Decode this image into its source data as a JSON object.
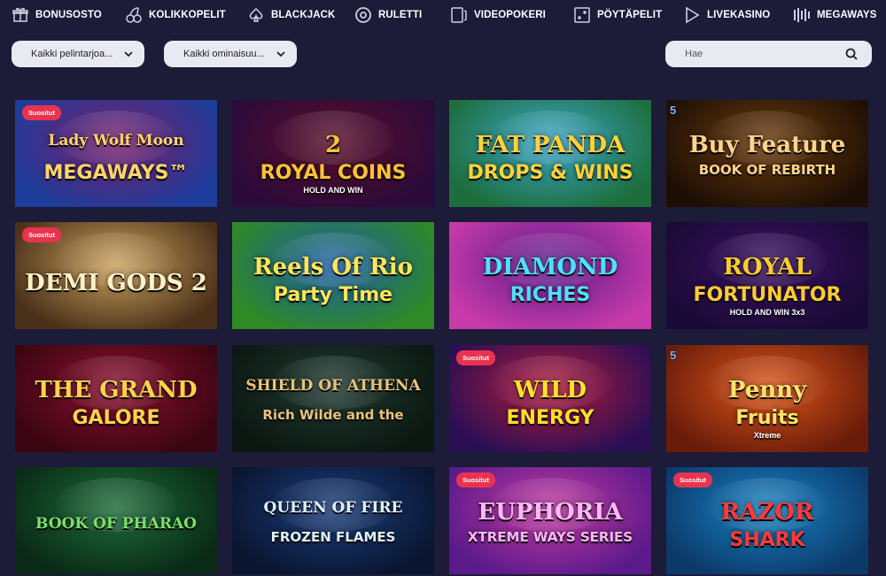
{
  "nav": [
    {
      "label": "BONUSOSTO",
      "icon": "gift-icon"
    },
    {
      "label": "KOLIKKOPELIT",
      "icon": "cherries-icon"
    },
    {
      "label": "BLACKJACK",
      "icon": "spade-icon"
    },
    {
      "label": "RULETTI",
      "icon": "roulette-icon"
    },
    {
      "label": "VIDEOPOKERI",
      "icon": "video-poker-icon"
    },
    {
      "label": "PÖYTÄPELIT",
      "icon": "table-games-icon"
    },
    {
      "label": "LIVEKASINO",
      "icon": "play-icon"
    },
    {
      "label": "MEGAWAYS",
      "icon": "megaways-icon"
    }
  ],
  "filters": {
    "provider": "Kaikki pelintarjoa...",
    "features": "Kaikki ominaisuu...",
    "search_placeholder": "Hae"
  },
  "badge_label": "Suositut",
  "games": [
    {
      "title": "Lady Wolf Moon",
      "subtitle": "MEGAWAYS™",
      "badge": true,
      "number": "",
      "bg1": "#7a1f6b",
      "bg2": "#1d3d9c",
      "color": "#ffd56a"
    },
    {
      "title": "2",
      "subtitle": "ROYAL COINS",
      "sub2": "HOLD AND WIN",
      "badge": false,
      "number": "",
      "bg1": "#5a0f2a",
      "bg2": "#2a0a3a",
      "color": "#ffc233"
    },
    {
      "title": "FAT PANDA",
      "subtitle": "DROPS & WINS",
      "badge": false,
      "number": "",
      "bg1": "#3ba6c9",
      "bg2": "#1d6e3c",
      "color": "#ffd23a"
    },
    {
      "title": "Buy Feature",
      "subtitle": "BOOK OF REBIRTH",
      "badge": false,
      "number": "5",
      "bg1": "#6b3b0d",
      "bg2": "#1e0f05",
      "color": "#ffd38a"
    },
    {
      "title": "DEMI GODS 2",
      "subtitle": "",
      "badge": true,
      "number": "",
      "bg1": "#c9a15e",
      "bg2": "#4a3018",
      "color": "#fff1c8"
    },
    {
      "title": "Reels Of Rio",
      "subtitle": "Party Time",
      "badge": false,
      "number": "",
      "bg1": "#1f5da8",
      "bg2": "#2e8a24",
      "color": "#ffe55a"
    },
    {
      "title": "DIAMOND",
      "subtitle": "RICHES",
      "badge": false,
      "number": "",
      "bg1": "#5a1d8c",
      "bg2": "#c73aa8",
      "color": "#4ee0ff"
    },
    {
      "title": "ROYAL",
      "subtitle": "FORTUNATOR",
      "sub2": "HOLD AND WIN 3x3",
      "badge": false,
      "number": "",
      "bg1": "#3a1060",
      "bg2": "#1a0a36",
      "color": "#ffcc2e"
    },
    {
      "title": "THE GRAND",
      "subtitle": "GALORE",
      "badge": false,
      "number": "",
      "bg1": "#8a1030",
      "bg2": "#3b0512",
      "color": "#ffd24a"
    },
    {
      "title": "SHIELD OF ATHENA",
      "subtitle": "Rich Wilde and the",
      "badge": false,
      "number": "",
      "bg1": "#1f3a30",
      "bg2": "#0c1712",
      "color": "#e9c27a"
    },
    {
      "title": "WILD",
      "subtitle": "ENERGY",
      "badge": true,
      "number": "",
      "bg1": "#b21a3a",
      "bg2": "#2a0f55",
      "color": "#ffe02a"
    },
    {
      "title": "Penny",
      "subtitle": "Fruits",
      "sub2": "Xtreme",
      "badge": false,
      "number": "5",
      "bg1": "#d9551a",
      "bg2": "#6a1c0a",
      "color": "#ffe36a"
    },
    {
      "title": "BOOK OF PHARAO",
      "subtitle": "",
      "badge": false,
      "number": "",
      "bg1": "#1d6b3a",
      "bg2": "#0a2a16",
      "color": "#7be06a"
    },
    {
      "title": "QUEEN OF FIRE",
      "subtitle": "FROZEN FLAMES",
      "badge": false,
      "number": "",
      "bg1": "#1a3d7a",
      "bg2": "#0a1530",
      "color": "#dff0ff"
    },
    {
      "title": "EUPHORIA",
      "subtitle": "XTREME WAYS SERIES",
      "badge": true,
      "number": "",
      "bg1": "#c23aa0",
      "bg2": "#5a1a8a",
      "color": "#ffb8f5"
    },
    {
      "title": "RAZOR",
      "subtitle": "SHARK",
      "badge": true,
      "number": "",
      "bg1": "#1a82c4",
      "bg2": "#0b3a6a",
      "color": "#ff3a3a"
    }
  ]
}
